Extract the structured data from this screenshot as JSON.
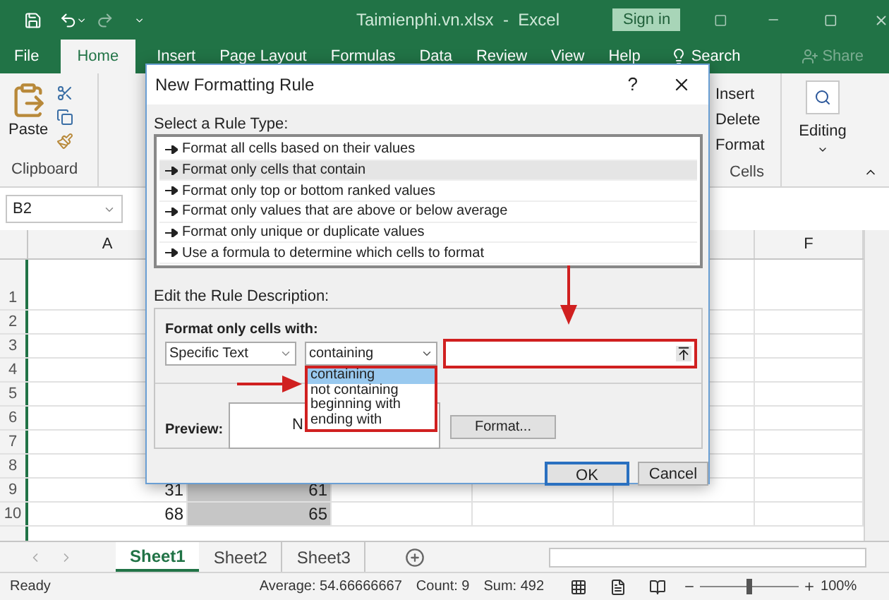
{
  "window": {
    "title": "Taimienphi.vn.xlsx  -  Excel",
    "sign_in": "Sign in"
  },
  "ribbon_tabs": [
    {
      "label": "File",
      "selected": false
    },
    {
      "label": "Home",
      "selected": true
    },
    {
      "label": "Insert",
      "selected": false
    },
    {
      "label": "Page Layout",
      "selected": false
    },
    {
      "label": "Formulas",
      "selected": false
    },
    {
      "label": "Data",
      "selected": false
    },
    {
      "label": "Review",
      "selected": false
    },
    {
      "label": "View",
      "selected": false
    },
    {
      "label": "Help",
      "selected": false
    }
  ],
  "tell_me": "Search",
  "share": "Share",
  "ribbon": {
    "paste": "Paste",
    "clipboard_group": "Clipboard",
    "cells_items": [
      "Insert",
      "Delete",
      "Format"
    ],
    "cells_group": "Cells",
    "editing": "Editing"
  },
  "name_box": "B2",
  "columns": [
    "A",
    "F"
  ],
  "grid_rows": [
    {
      "number": "1"
    },
    {
      "number": "2"
    },
    {
      "number": "3"
    },
    {
      "number": "4"
    },
    {
      "number": "5"
    },
    {
      "number": "6"
    },
    {
      "number": "7"
    },
    {
      "number": "8"
    },
    {
      "number": "9",
      "cells": [
        "31",
        "61"
      ]
    },
    {
      "number": "10",
      "cells": [
        "68",
        "65"
      ]
    }
  ],
  "sheets": [
    {
      "label": "Sheet1",
      "selected": true
    },
    {
      "label": "Sheet2",
      "selected": false
    },
    {
      "label": "Sheet3",
      "selected": false
    }
  ],
  "status_bar": {
    "state": "Ready",
    "average": "Average: 54.66666667",
    "count": "Count: 9",
    "sum": "Sum: 492",
    "zoom": "100%",
    "level": 0.5
  },
  "dialog": {
    "title": "New Formatting Rule",
    "help": "?",
    "select_label": "Select a Rule Type:",
    "rule_types": [
      {
        "label": "Format all cells based on their values",
        "selected": false
      },
      {
        "label": "Format only cells that contain",
        "selected": true
      },
      {
        "label": "Format only top or bottom ranked values",
        "selected": false
      },
      {
        "label": "Format only values that are above or below average",
        "selected": false
      },
      {
        "label": "Format only unique or duplicate values",
        "selected": false
      },
      {
        "label": "Use a formula to determine which cells to format",
        "selected": false
      }
    ],
    "edit_label": "Edit the Rule Description:",
    "format_with_label": "Format only cells with:",
    "type_combo": "Specific Text",
    "operator_combo": "containing",
    "operator_options": [
      {
        "label": "containing",
        "selected": true
      },
      {
        "label": "not containing",
        "selected": false
      },
      {
        "label": "beginning with",
        "selected": false
      },
      {
        "label": "ending with",
        "selected": false
      }
    ],
    "preview_label": "Preview:",
    "preview_text": "N",
    "format_button": "Format...",
    "ok": "OK",
    "cancel": "Cancel"
  }
}
